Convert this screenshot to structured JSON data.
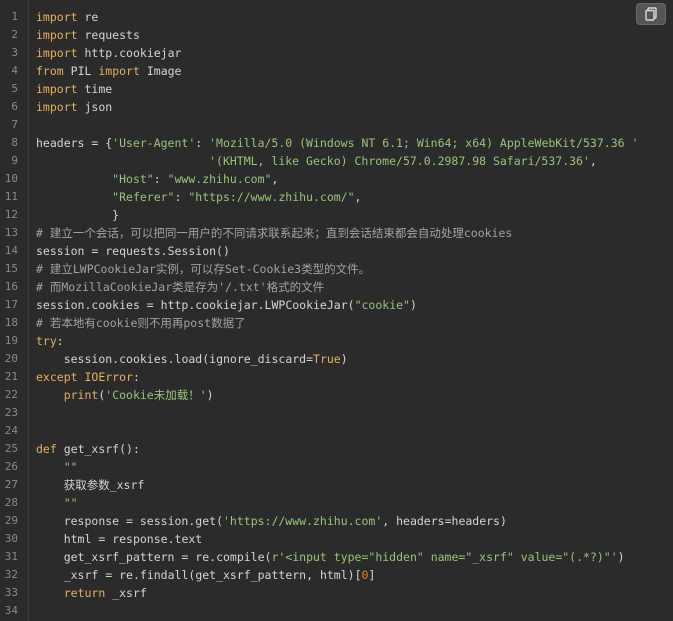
{
  "toolbar": {
    "copy_icon": "copy-icon"
  },
  "code": {
    "lines": [
      {
        "n": "1",
        "t": "import re"
      },
      {
        "n": "2",
        "t": "import requests"
      },
      {
        "n": "3",
        "t": "import http.cookiejar"
      },
      {
        "n": "4",
        "t": "from PIL import Image"
      },
      {
        "n": "5",
        "t": "import time"
      },
      {
        "n": "6",
        "t": "import json"
      },
      {
        "n": "7",
        "t": ""
      },
      {
        "n": "8",
        "t": "headers = {'User-Agent': 'Mozilla/5.0 (Windows NT 6.1; Win64; x64) AppleWebKit/537.36 '"
      },
      {
        "n": "9",
        "t": "                         '(KHTML, like Gecko) Chrome/57.0.2987.98 Safari/537.36',"
      },
      {
        "n": "10",
        "t": "           \"Host\": \"www.zhihu.com\","
      },
      {
        "n": "11",
        "t": "           \"Referer\": \"https://www.zhihu.com/\","
      },
      {
        "n": "12",
        "t": "           }"
      },
      {
        "n": "13",
        "t": "# 建立一个会话，可以把同一用户的不同请求联系起来；直到会话结束都会自动处理cookies"
      },
      {
        "n": "14",
        "t": "session = requests.Session()"
      },
      {
        "n": "15",
        "t": "# 建立LWPCookieJar实例，可以存Set-Cookie3类型的文件。"
      },
      {
        "n": "16",
        "t": "# 而MozillaCookieJar类是存为'/.txt'格式的文件"
      },
      {
        "n": "17",
        "t": "session.cookies = http.cookiejar.LWPCookieJar(\"cookie\")"
      },
      {
        "n": "18",
        "t": "# 若本地有cookie则不用再post数据了"
      },
      {
        "n": "19",
        "t": "try:"
      },
      {
        "n": "20",
        "t": "    session.cookies.load(ignore_discard=True)"
      },
      {
        "n": "21",
        "t": "except IOError:"
      },
      {
        "n": "22",
        "t": "    print('Cookie未加载！')"
      },
      {
        "n": "23",
        "t": ""
      },
      {
        "n": "24",
        "t": ""
      },
      {
        "n": "25",
        "t": "def get_xsrf():"
      },
      {
        "n": "26",
        "t": "    \"\"\""
      },
      {
        "n": "27",
        "t": "    获取参数_xsrf"
      },
      {
        "n": "28",
        "t": "    \"\"\""
      },
      {
        "n": "29",
        "t": "    response = session.get('https://www.zhihu.com', headers=headers)"
      },
      {
        "n": "30",
        "t": "    html = response.text"
      },
      {
        "n": "31",
        "t": "    get_xsrf_pattern = re.compile(r'<input type=\"hidden\" name=\"_xsrf\" value=\"(.*?)\"')"
      },
      {
        "n": "32",
        "t": "    _xsrf = re.findall(get_xsrf_pattern, html)[0]"
      },
      {
        "n": "33",
        "t": "    return _xsrf"
      },
      {
        "n": "34",
        "t": ""
      }
    ]
  }
}
